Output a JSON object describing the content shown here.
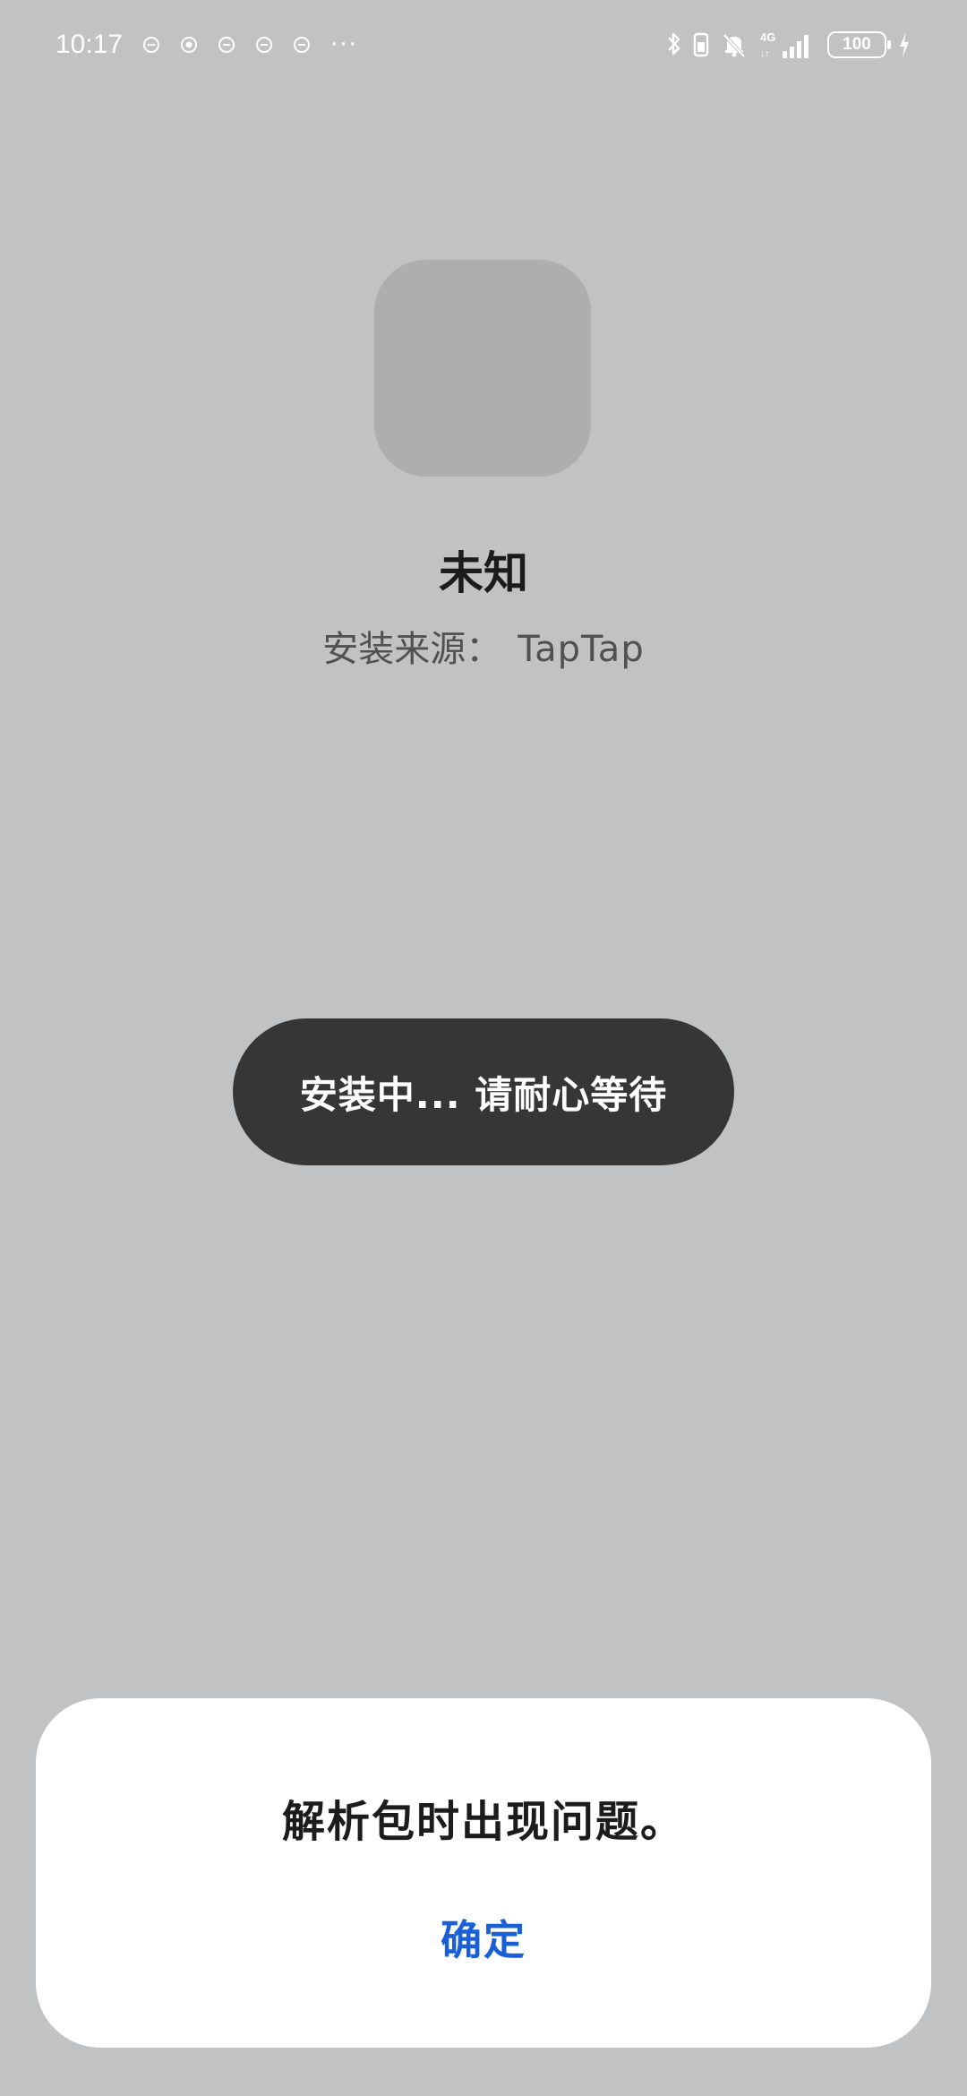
{
  "status_bar": {
    "time": "10:17",
    "notification_icons": [
      "chat-icon",
      "message-icon",
      "chat-icon",
      "chat-icon",
      "chat-icon"
    ],
    "more": "···",
    "battery": "100",
    "network": "4G"
  },
  "app": {
    "name": "未知",
    "source_label": "安装来源：",
    "source_value": "TapTap"
  },
  "install_status": "安装中... 请耐心等待",
  "dialog": {
    "message": "解析包时出现问题。",
    "ok_label": "确定"
  },
  "colors": {
    "background": "#c1c2c4",
    "pill": "#363636",
    "accent": "#1a5fd6"
  }
}
